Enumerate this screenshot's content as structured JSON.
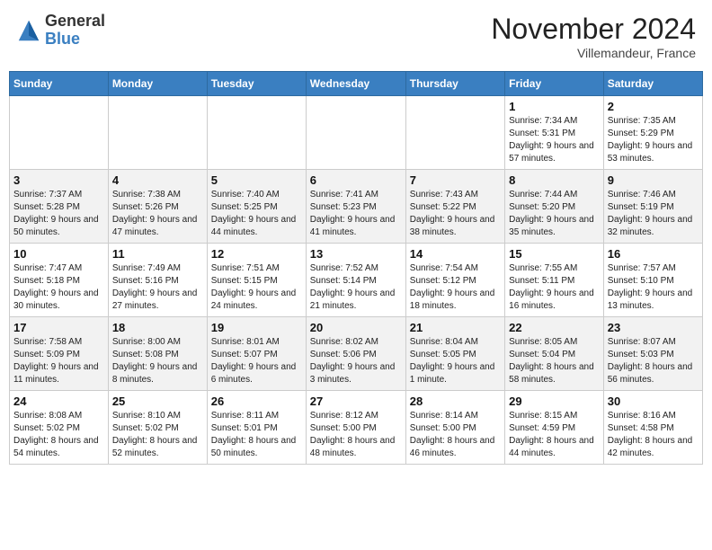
{
  "header": {
    "logo_general": "General",
    "logo_blue": "Blue",
    "month": "November 2024",
    "location": "Villemandeur, France"
  },
  "weekdays": [
    "Sunday",
    "Monday",
    "Tuesday",
    "Wednesday",
    "Thursday",
    "Friday",
    "Saturday"
  ],
  "weeks": [
    [
      {
        "day": "",
        "sunrise": "",
        "sunset": "",
        "daylight": ""
      },
      {
        "day": "",
        "sunrise": "",
        "sunset": "",
        "daylight": ""
      },
      {
        "day": "",
        "sunrise": "",
        "sunset": "",
        "daylight": ""
      },
      {
        "day": "",
        "sunrise": "",
        "sunset": "",
        "daylight": ""
      },
      {
        "day": "",
        "sunrise": "",
        "sunset": "",
        "daylight": ""
      },
      {
        "day": "1",
        "sunrise": "Sunrise: 7:34 AM",
        "sunset": "Sunset: 5:31 PM",
        "daylight": "Daylight: 9 hours and 57 minutes."
      },
      {
        "day": "2",
        "sunrise": "Sunrise: 7:35 AM",
        "sunset": "Sunset: 5:29 PM",
        "daylight": "Daylight: 9 hours and 53 minutes."
      }
    ],
    [
      {
        "day": "3",
        "sunrise": "Sunrise: 7:37 AM",
        "sunset": "Sunset: 5:28 PM",
        "daylight": "Daylight: 9 hours and 50 minutes."
      },
      {
        "day": "4",
        "sunrise": "Sunrise: 7:38 AM",
        "sunset": "Sunset: 5:26 PM",
        "daylight": "Daylight: 9 hours and 47 minutes."
      },
      {
        "day": "5",
        "sunrise": "Sunrise: 7:40 AM",
        "sunset": "Sunset: 5:25 PM",
        "daylight": "Daylight: 9 hours and 44 minutes."
      },
      {
        "day": "6",
        "sunrise": "Sunrise: 7:41 AM",
        "sunset": "Sunset: 5:23 PM",
        "daylight": "Daylight: 9 hours and 41 minutes."
      },
      {
        "day": "7",
        "sunrise": "Sunrise: 7:43 AM",
        "sunset": "Sunset: 5:22 PM",
        "daylight": "Daylight: 9 hours and 38 minutes."
      },
      {
        "day": "8",
        "sunrise": "Sunrise: 7:44 AM",
        "sunset": "Sunset: 5:20 PM",
        "daylight": "Daylight: 9 hours and 35 minutes."
      },
      {
        "day": "9",
        "sunrise": "Sunrise: 7:46 AM",
        "sunset": "Sunset: 5:19 PM",
        "daylight": "Daylight: 9 hours and 32 minutes."
      }
    ],
    [
      {
        "day": "10",
        "sunrise": "Sunrise: 7:47 AM",
        "sunset": "Sunset: 5:18 PM",
        "daylight": "Daylight: 9 hours and 30 minutes."
      },
      {
        "day": "11",
        "sunrise": "Sunrise: 7:49 AM",
        "sunset": "Sunset: 5:16 PM",
        "daylight": "Daylight: 9 hours and 27 minutes."
      },
      {
        "day": "12",
        "sunrise": "Sunrise: 7:51 AM",
        "sunset": "Sunset: 5:15 PM",
        "daylight": "Daylight: 9 hours and 24 minutes."
      },
      {
        "day": "13",
        "sunrise": "Sunrise: 7:52 AM",
        "sunset": "Sunset: 5:14 PM",
        "daylight": "Daylight: 9 hours and 21 minutes."
      },
      {
        "day": "14",
        "sunrise": "Sunrise: 7:54 AM",
        "sunset": "Sunset: 5:12 PM",
        "daylight": "Daylight: 9 hours and 18 minutes."
      },
      {
        "day": "15",
        "sunrise": "Sunrise: 7:55 AM",
        "sunset": "Sunset: 5:11 PM",
        "daylight": "Daylight: 9 hours and 16 minutes."
      },
      {
        "day": "16",
        "sunrise": "Sunrise: 7:57 AM",
        "sunset": "Sunset: 5:10 PM",
        "daylight": "Daylight: 9 hours and 13 minutes."
      }
    ],
    [
      {
        "day": "17",
        "sunrise": "Sunrise: 7:58 AM",
        "sunset": "Sunset: 5:09 PM",
        "daylight": "Daylight: 9 hours and 11 minutes."
      },
      {
        "day": "18",
        "sunrise": "Sunrise: 8:00 AM",
        "sunset": "Sunset: 5:08 PM",
        "daylight": "Daylight: 9 hours and 8 minutes."
      },
      {
        "day": "19",
        "sunrise": "Sunrise: 8:01 AM",
        "sunset": "Sunset: 5:07 PM",
        "daylight": "Daylight: 9 hours and 6 minutes."
      },
      {
        "day": "20",
        "sunrise": "Sunrise: 8:02 AM",
        "sunset": "Sunset: 5:06 PM",
        "daylight": "Daylight: 9 hours and 3 minutes."
      },
      {
        "day": "21",
        "sunrise": "Sunrise: 8:04 AM",
        "sunset": "Sunset: 5:05 PM",
        "daylight": "Daylight: 9 hours and 1 minute."
      },
      {
        "day": "22",
        "sunrise": "Sunrise: 8:05 AM",
        "sunset": "Sunset: 5:04 PM",
        "daylight": "Daylight: 8 hours and 58 minutes."
      },
      {
        "day": "23",
        "sunrise": "Sunrise: 8:07 AM",
        "sunset": "Sunset: 5:03 PM",
        "daylight": "Daylight: 8 hours and 56 minutes."
      }
    ],
    [
      {
        "day": "24",
        "sunrise": "Sunrise: 8:08 AM",
        "sunset": "Sunset: 5:02 PM",
        "daylight": "Daylight: 8 hours and 54 minutes."
      },
      {
        "day": "25",
        "sunrise": "Sunrise: 8:10 AM",
        "sunset": "Sunset: 5:02 PM",
        "daylight": "Daylight: 8 hours and 52 minutes."
      },
      {
        "day": "26",
        "sunrise": "Sunrise: 8:11 AM",
        "sunset": "Sunset: 5:01 PM",
        "daylight": "Daylight: 8 hours and 50 minutes."
      },
      {
        "day": "27",
        "sunrise": "Sunrise: 8:12 AM",
        "sunset": "Sunset: 5:00 PM",
        "daylight": "Daylight: 8 hours and 48 minutes."
      },
      {
        "day": "28",
        "sunrise": "Sunrise: 8:14 AM",
        "sunset": "Sunset: 5:00 PM",
        "daylight": "Daylight: 8 hours and 46 minutes."
      },
      {
        "day": "29",
        "sunrise": "Sunrise: 8:15 AM",
        "sunset": "Sunset: 4:59 PM",
        "daylight": "Daylight: 8 hours and 44 minutes."
      },
      {
        "day": "30",
        "sunrise": "Sunrise: 8:16 AM",
        "sunset": "Sunset: 4:58 PM",
        "daylight": "Daylight: 8 hours and 42 minutes."
      }
    ]
  ]
}
